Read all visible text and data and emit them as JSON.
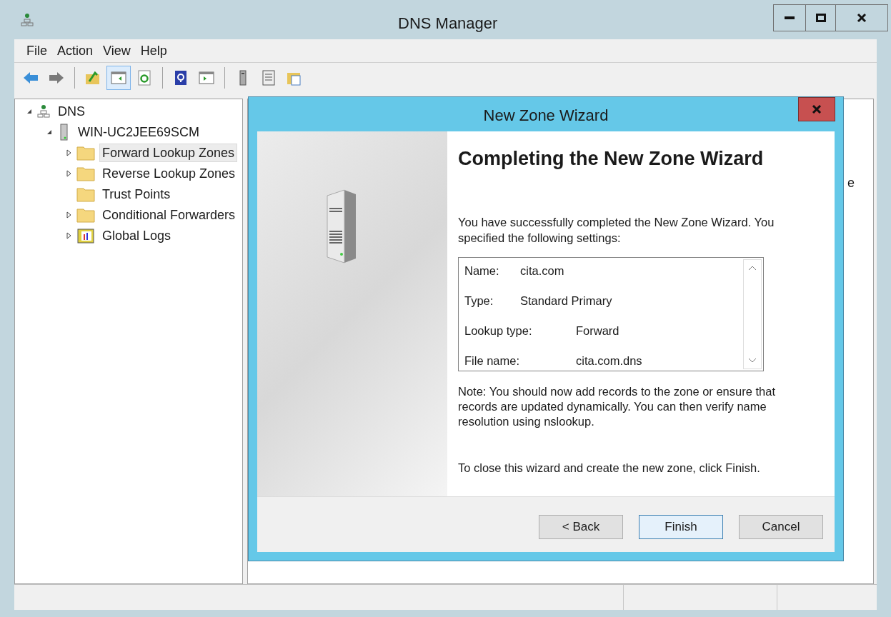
{
  "window": {
    "title": "DNS Manager"
  },
  "menu": [
    "File",
    "Action",
    "View",
    "Help"
  ],
  "toolbar": [
    {
      "kind": "back",
      "pressed": false
    },
    {
      "kind": "forward",
      "pressed": false
    },
    {
      "kind": "sep"
    },
    {
      "kind": "up",
      "pressed": false
    },
    {
      "kind": "tree",
      "pressed": true
    },
    {
      "kind": "refresh",
      "pressed": false
    },
    {
      "kind": "sep"
    },
    {
      "kind": "help",
      "pressed": false
    },
    {
      "kind": "pane",
      "pressed": false
    },
    {
      "kind": "sep"
    },
    {
      "kind": "server",
      "pressed": false
    },
    {
      "kind": "list",
      "pressed": false
    },
    {
      "kind": "props",
      "pressed": false
    }
  ],
  "tree": [
    {
      "label": "DNS",
      "kind": "dns",
      "expanded": true,
      "children": [
        {
          "label": "WIN-UC2JEE69SCM",
          "kind": "server",
          "expanded": true,
          "children": [
            {
              "label": "Forward Lookup Zones",
              "kind": "folder",
              "expandable": true,
              "selected": true
            },
            {
              "label": "Reverse Lookup Zones",
              "kind": "folder",
              "expandable": true,
              "selected": false
            },
            {
              "label": "Trust Points",
              "kind": "folder",
              "expandable": false,
              "selected": false
            },
            {
              "label": "Conditional Forwarders",
              "kind": "folder",
              "expandable": true,
              "selected": false
            },
            {
              "label": "Global Logs",
              "kind": "log",
              "expandable": true,
              "selected": false
            }
          ]
        }
      ]
    }
  ],
  "right_pane": {
    "text": "e"
  },
  "dialog": {
    "title": "New Zone Wizard",
    "heading": "Completing the New Zone Wizard",
    "intro": "You have successfully completed the New Zone Wizard. You specified the following settings:",
    "settings": [
      {
        "label": "Name:",
        "value": "cita.com"
      },
      {
        "label": "Type:",
        "value": "Standard Primary"
      },
      {
        "label": "Lookup type:",
        "value": "Forward"
      },
      {
        "label": "File name:",
        "value": "cita.com.dns"
      }
    ],
    "note": "Note: You should now add records to the zone or ensure that records are updated dynamically. You can then verify name resolution using nslookup.",
    "closing": "To close this wizard and create the new zone, click Finish.",
    "buttons": [
      {
        "label": "< Back",
        "default": false
      },
      {
        "label": "Finish",
        "default": true
      },
      {
        "label": "Cancel",
        "default": false
      }
    ]
  }
}
